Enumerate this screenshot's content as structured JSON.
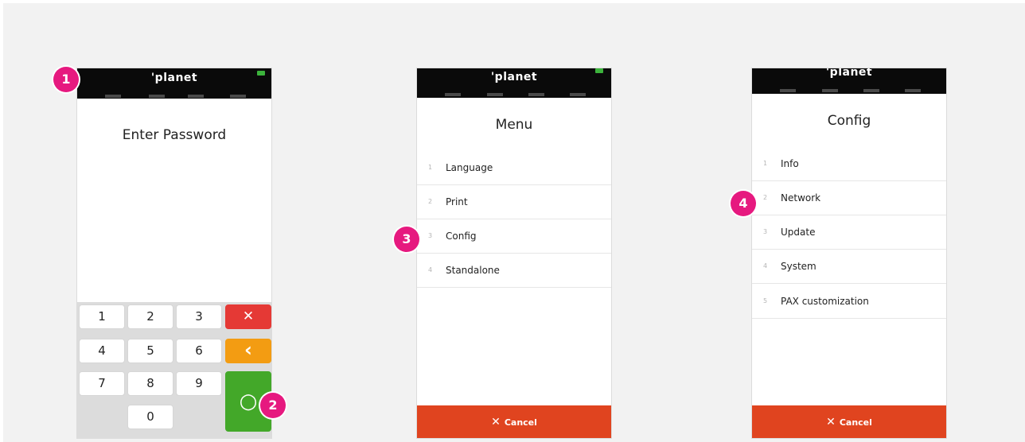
{
  "brand": "'planet",
  "screen1": {
    "title": "Enter Password",
    "keys": [
      "1",
      "2",
      "3",
      "4",
      "5",
      "6",
      "7",
      "8",
      "9",
      "0"
    ],
    "clear_glyph": "✕",
    "back_glyph": "‹",
    "ok_glyph": "○"
  },
  "screen2": {
    "title": "Menu",
    "items": [
      {
        "num": "1",
        "label": "Language"
      },
      {
        "num": "2",
        "label": "Print"
      },
      {
        "num": "3",
        "label": "Config"
      },
      {
        "num": "4",
        "label": "Standalone"
      }
    ],
    "cancel_glyph": "✕",
    "cancel_label": "Cancel"
  },
  "screen3": {
    "title": "Config",
    "items": [
      {
        "num": "1",
        "label": "Info"
      },
      {
        "num": "2",
        "label": "Network"
      },
      {
        "num": "3",
        "label": "Update"
      },
      {
        "num": "4",
        "label": "System"
      },
      {
        "num": "5",
        "label": "PAX customization"
      }
    ],
    "cancel_glyph": "✕",
    "cancel_label": "Cancel"
  },
  "badges": [
    "1",
    "2",
    "3",
    "4"
  ],
  "colors": {
    "header": "#0a0a0a",
    "accent_badge": "#e6197f",
    "cancel_red": "#e0441f",
    "key_clear": "#e53935",
    "key_back": "#f39c12",
    "key_ok": "#43a829",
    "battery": "#3cb33c"
  }
}
